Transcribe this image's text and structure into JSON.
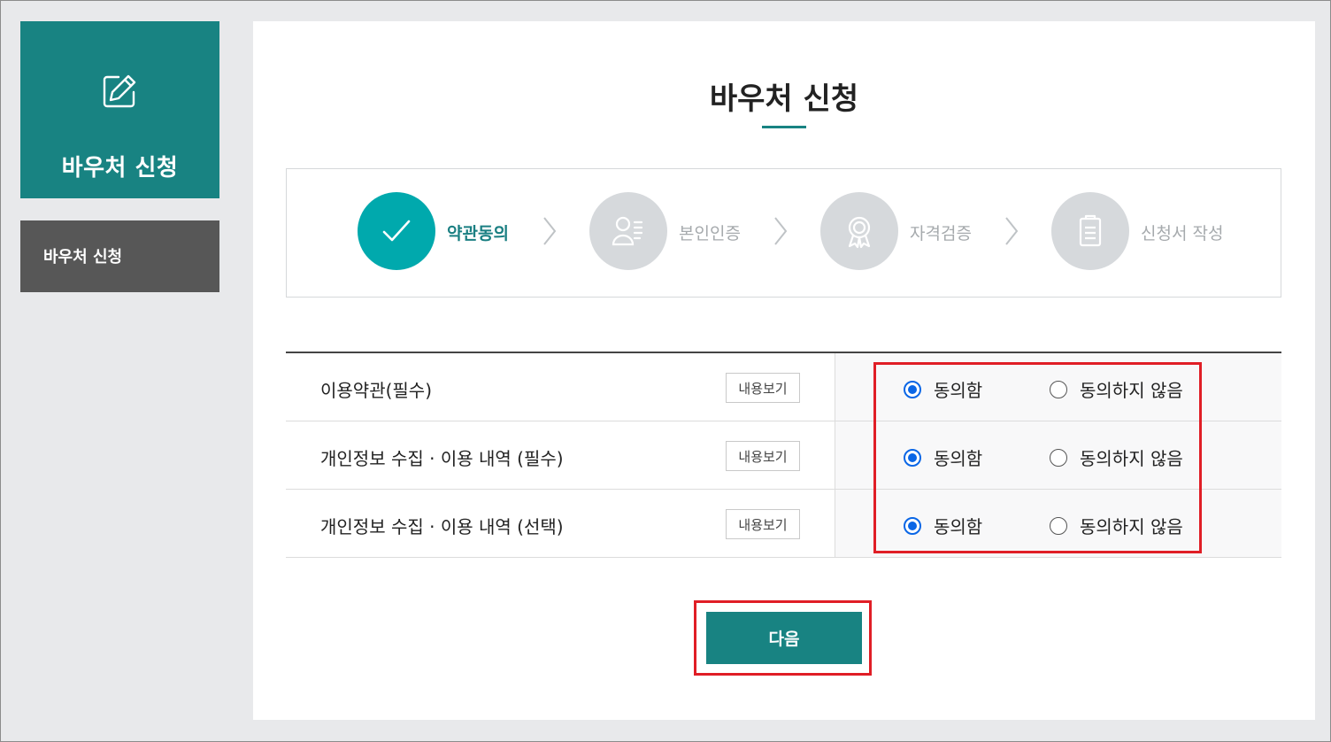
{
  "sidebar": {
    "header_title": "바우처 신청",
    "header_icon": "edit-icon",
    "menu_item": "바우처 신청"
  },
  "page": {
    "title": "바우처 신청"
  },
  "steps": [
    {
      "label": "약관동의",
      "icon": "check-icon",
      "active": true
    },
    {
      "label": "본인인증",
      "icon": "identity-icon",
      "active": false
    },
    {
      "label": "자격검증",
      "icon": "award-icon",
      "active": false
    },
    {
      "label": "신청서 작성",
      "icon": "clipboard-icon",
      "active": false
    }
  ],
  "terms": [
    {
      "label": "이용약관(필수)",
      "view_button": "내용보기",
      "agree": "동의함",
      "disagree": "동의하지 않음",
      "agreed": true
    },
    {
      "label": "개인정보 수집 · 이용 내역 (필수)",
      "view_button": "내용보기",
      "agree": "동의함",
      "disagree": "동의하지 않음",
      "agreed": true
    },
    {
      "label": "개인정보 수집 · 이용 내역 (선택)",
      "view_button": "내용보기",
      "agree": "동의함",
      "disagree": "동의하지 않음",
      "agreed": true
    }
  ],
  "next_button": "다음",
  "colors": {
    "brand_teal": "#188382",
    "active_step": "#00a9ad",
    "inactive_step": "#d6d9dc",
    "highlight_red": "#e01e26",
    "radio_blue": "#0a66e6",
    "sidebar_menu_bg": "#575757"
  }
}
